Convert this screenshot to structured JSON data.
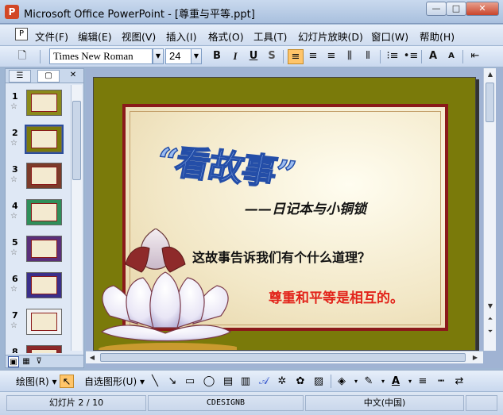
{
  "window": {
    "title": "Microsoft Office PowerPoint - [尊重与平等.ppt]",
    "app_icon": "P",
    "min": "—",
    "max": "□",
    "close": "✕"
  },
  "menu": {
    "items": [
      "文件(F)",
      "编辑(E)",
      "视图(V)",
      "插入(I)",
      "格式(O)",
      "工具(T)",
      "幻灯片放映(D)",
      "窗口(W)",
      "帮助(H)"
    ]
  },
  "toolbar": {
    "font_name": "Times New Roman",
    "font_size": "24",
    "bold": "B",
    "italic": "I",
    "underline": "U",
    "shadow": "S",
    "grow": "A",
    "shrink": "A"
  },
  "left_pane": {
    "tab_outline": "☰",
    "tab_slides": "▢",
    "close": "✕",
    "slides": [
      {
        "num": "1",
        "bg": "#8a8a1a"
      },
      {
        "num": "2",
        "bg": "#7a7a0a"
      },
      {
        "num": "3",
        "bg": "#7b3b2a"
      },
      {
        "num": "4",
        "bg": "#2f8f5a"
      },
      {
        "num": "5",
        "bg": "#5a2f7a"
      },
      {
        "num": "6",
        "bg": "#3a2f8a"
      },
      {
        "num": "7",
        "bg": "#f2f2f2"
      },
      {
        "num": "8",
        "bg": "#8a2a2a"
      }
    ]
  },
  "slide": {
    "wordart": "“看故事”",
    "subtitle": "——日记本与小铜锁",
    "question": "这故事告诉我们有个什么道理？",
    "answer": "尊重和平等是相互的。"
  },
  "drawbar": {
    "draw": "绘图(R)",
    "autoshapes": "自选图形(U)"
  },
  "status": {
    "slide": "幻灯片 2 / 10",
    "design": "CDESIGNB",
    "language": "中文(中国)"
  },
  "colors": {
    "accent": "#ffc56a",
    "frame": "#8b1a1a",
    "answer": "#e2231a",
    "slide_bg": "#7a7a0a"
  }
}
